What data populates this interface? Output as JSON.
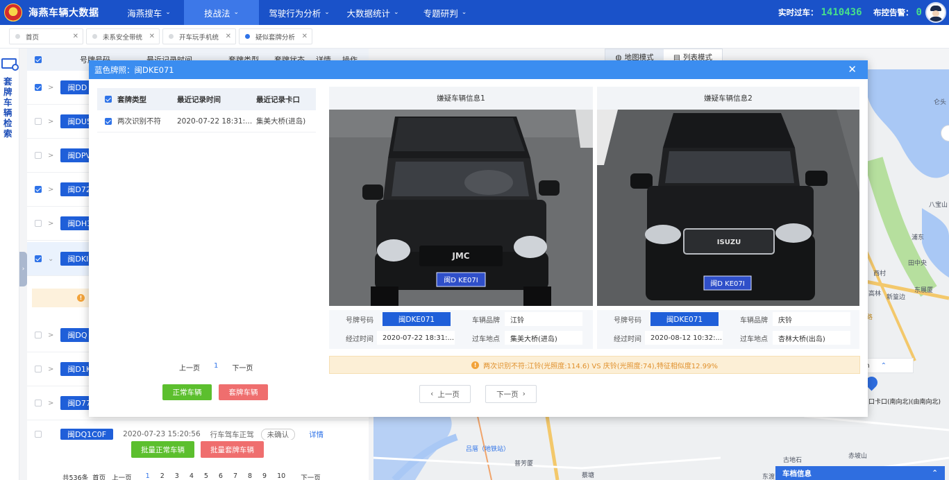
{
  "header": {
    "title": "海燕车辆大数据",
    "nav": [
      {
        "label": "海燕搜车",
        "active": false
      },
      {
        "label": "技战法",
        "active": true
      },
      {
        "label": "驾驶行为分析",
        "active": false
      },
      {
        "label": "大数据统计",
        "active": false
      },
      {
        "label": "专题研判",
        "active": false
      }
    ],
    "realtime_label": "实时过车：",
    "realtime_value": "1410436",
    "alarm_label": "布控告警：",
    "alarm_value": "0"
  },
  "tabs": [
    {
      "label": "首页",
      "active": false
    },
    {
      "label": "未系安全带统",
      "active": false
    },
    {
      "label": "开车玩手机统",
      "active": false
    },
    {
      "label": "疑似套牌分析",
      "active": true
    }
  ],
  "sidebar": {
    "title": "套牌车辆检索"
  },
  "list": {
    "headers": [
      "号牌号码",
      "最近记录时间",
      "套牌类型",
      "套牌状态",
      "详情",
      "操作"
    ],
    "rows": [
      {
        "plate": "闽DD",
        "checked": true,
        "expanded": false
      },
      {
        "plate": "闽DU5",
        "checked": false,
        "expanded": false
      },
      {
        "plate": "闽DPV",
        "checked": false,
        "expanded": false
      },
      {
        "plate": "闽D72",
        "checked": true,
        "expanded": false
      },
      {
        "plate": "闽DH3",
        "checked": false,
        "expanded": false
      },
      {
        "plate": "闽DKI",
        "checked": true,
        "expanded": true
      },
      {
        "plate": "闽DQ",
        "checked": false,
        "expanded": false
      },
      {
        "plate": "闽D1K",
        "checked": false,
        "expanded": false
      },
      {
        "plate": "闽D77",
        "checked": false,
        "expanded": false
      }
    ],
    "partial_row": {
      "plate": "闽DQ1C0F",
      "time": "2020-07-23 15:20:56",
      "type": "行车驾车正驾",
      "status": "未确认",
      "detail": "详情"
    },
    "batch_normal": "批量正常车辆",
    "batch_fake": "批量套牌车辆",
    "pager": {
      "total": "共536条",
      "first": "首页",
      "prev": "上一页",
      "pages": [
        "1",
        "2",
        "3",
        "4",
        "5",
        "6",
        "7",
        "8",
        "9",
        "10"
      ],
      "next": "下一页"
    }
  },
  "map": {
    "mode_map": "地图模式",
    "mode_list": "列表模式",
    "labels": [
      "仑头",
      "八宝山",
      "浦东",
      "田中央",
      "西村",
      "东展厦",
      "高林",
      "新篁边",
      "仙岳路",
      "口卡口(南向北)(由南向北)",
      "吕厝（地铁站）",
      "普芳厦",
      "古地石",
      "赤坡山",
      "蔡塘",
      "东渡"
    ],
    "popup_text": "sh",
    "info_title": "车档信息"
  },
  "modal": {
    "title": "蓝色牌照：闽DKE071",
    "table": {
      "headers": [
        "套牌类型",
        "最近记录时间",
        "最近记录卡口"
      ],
      "rows": [
        {
          "type": "两次识别不符",
          "time": "2020-07-22 18:31:...",
          "bayonet": "集美大桥(进岛)"
        }
      ]
    },
    "pager": {
      "prev": "上一页",
      "page": "1",
      "next": "下一页"
    },
    "btn_normal": "正常车辆",
    "btn_fake": "套牌车辆",
    "cards": [
      {
        "title": "嫌疑车辆信息1",
        "plate_label": "号牌号码",
        "plate": "闽DKE071",
        "brand_label": "车辆品牌",
        "brand": "江铃",
        "time_label": "经过时间",
        "time": "2020-07-22 18:31:...",
        "place_label": "过车地点",
        "place": "集美大桥(进岛)",
        "photo_grille": "JMC",
        "photo_plate": "闽D KE07I"
      },
      {
        "title": "嫌疑车辆信息2",
        "plate_label": "号牌号码",
        "plate": "闽DKE071",
        "brand_label": "车辆品牌",
        "brand": "庆铃",
        "time_label": "经过时间",
        "time": "2020-08-12 10:32:...",
        "place_label": "过车地点",
        "place": "杏林大桥(出岛)",
        "photo_grille": "ISUZU",
        "photo_plate": "闽D KE07I"
      }
    ],
    "alert": "两次识别不符:江铃(光照度:114.6) VS 庆铃(光照度:74),特征相似度12.99%",
    "prev_btn": "上一页",
    "next_btn": "下一页"
  },
  "colors": {
    "primary": "#1a52c9",
    "accent": "#2f73e8",
    "green": "#5cbf2e",
    "red": "#ef6e6e",
    "warn": "#f2a33a",
    "realtime": "#47e08a"
  }
}
